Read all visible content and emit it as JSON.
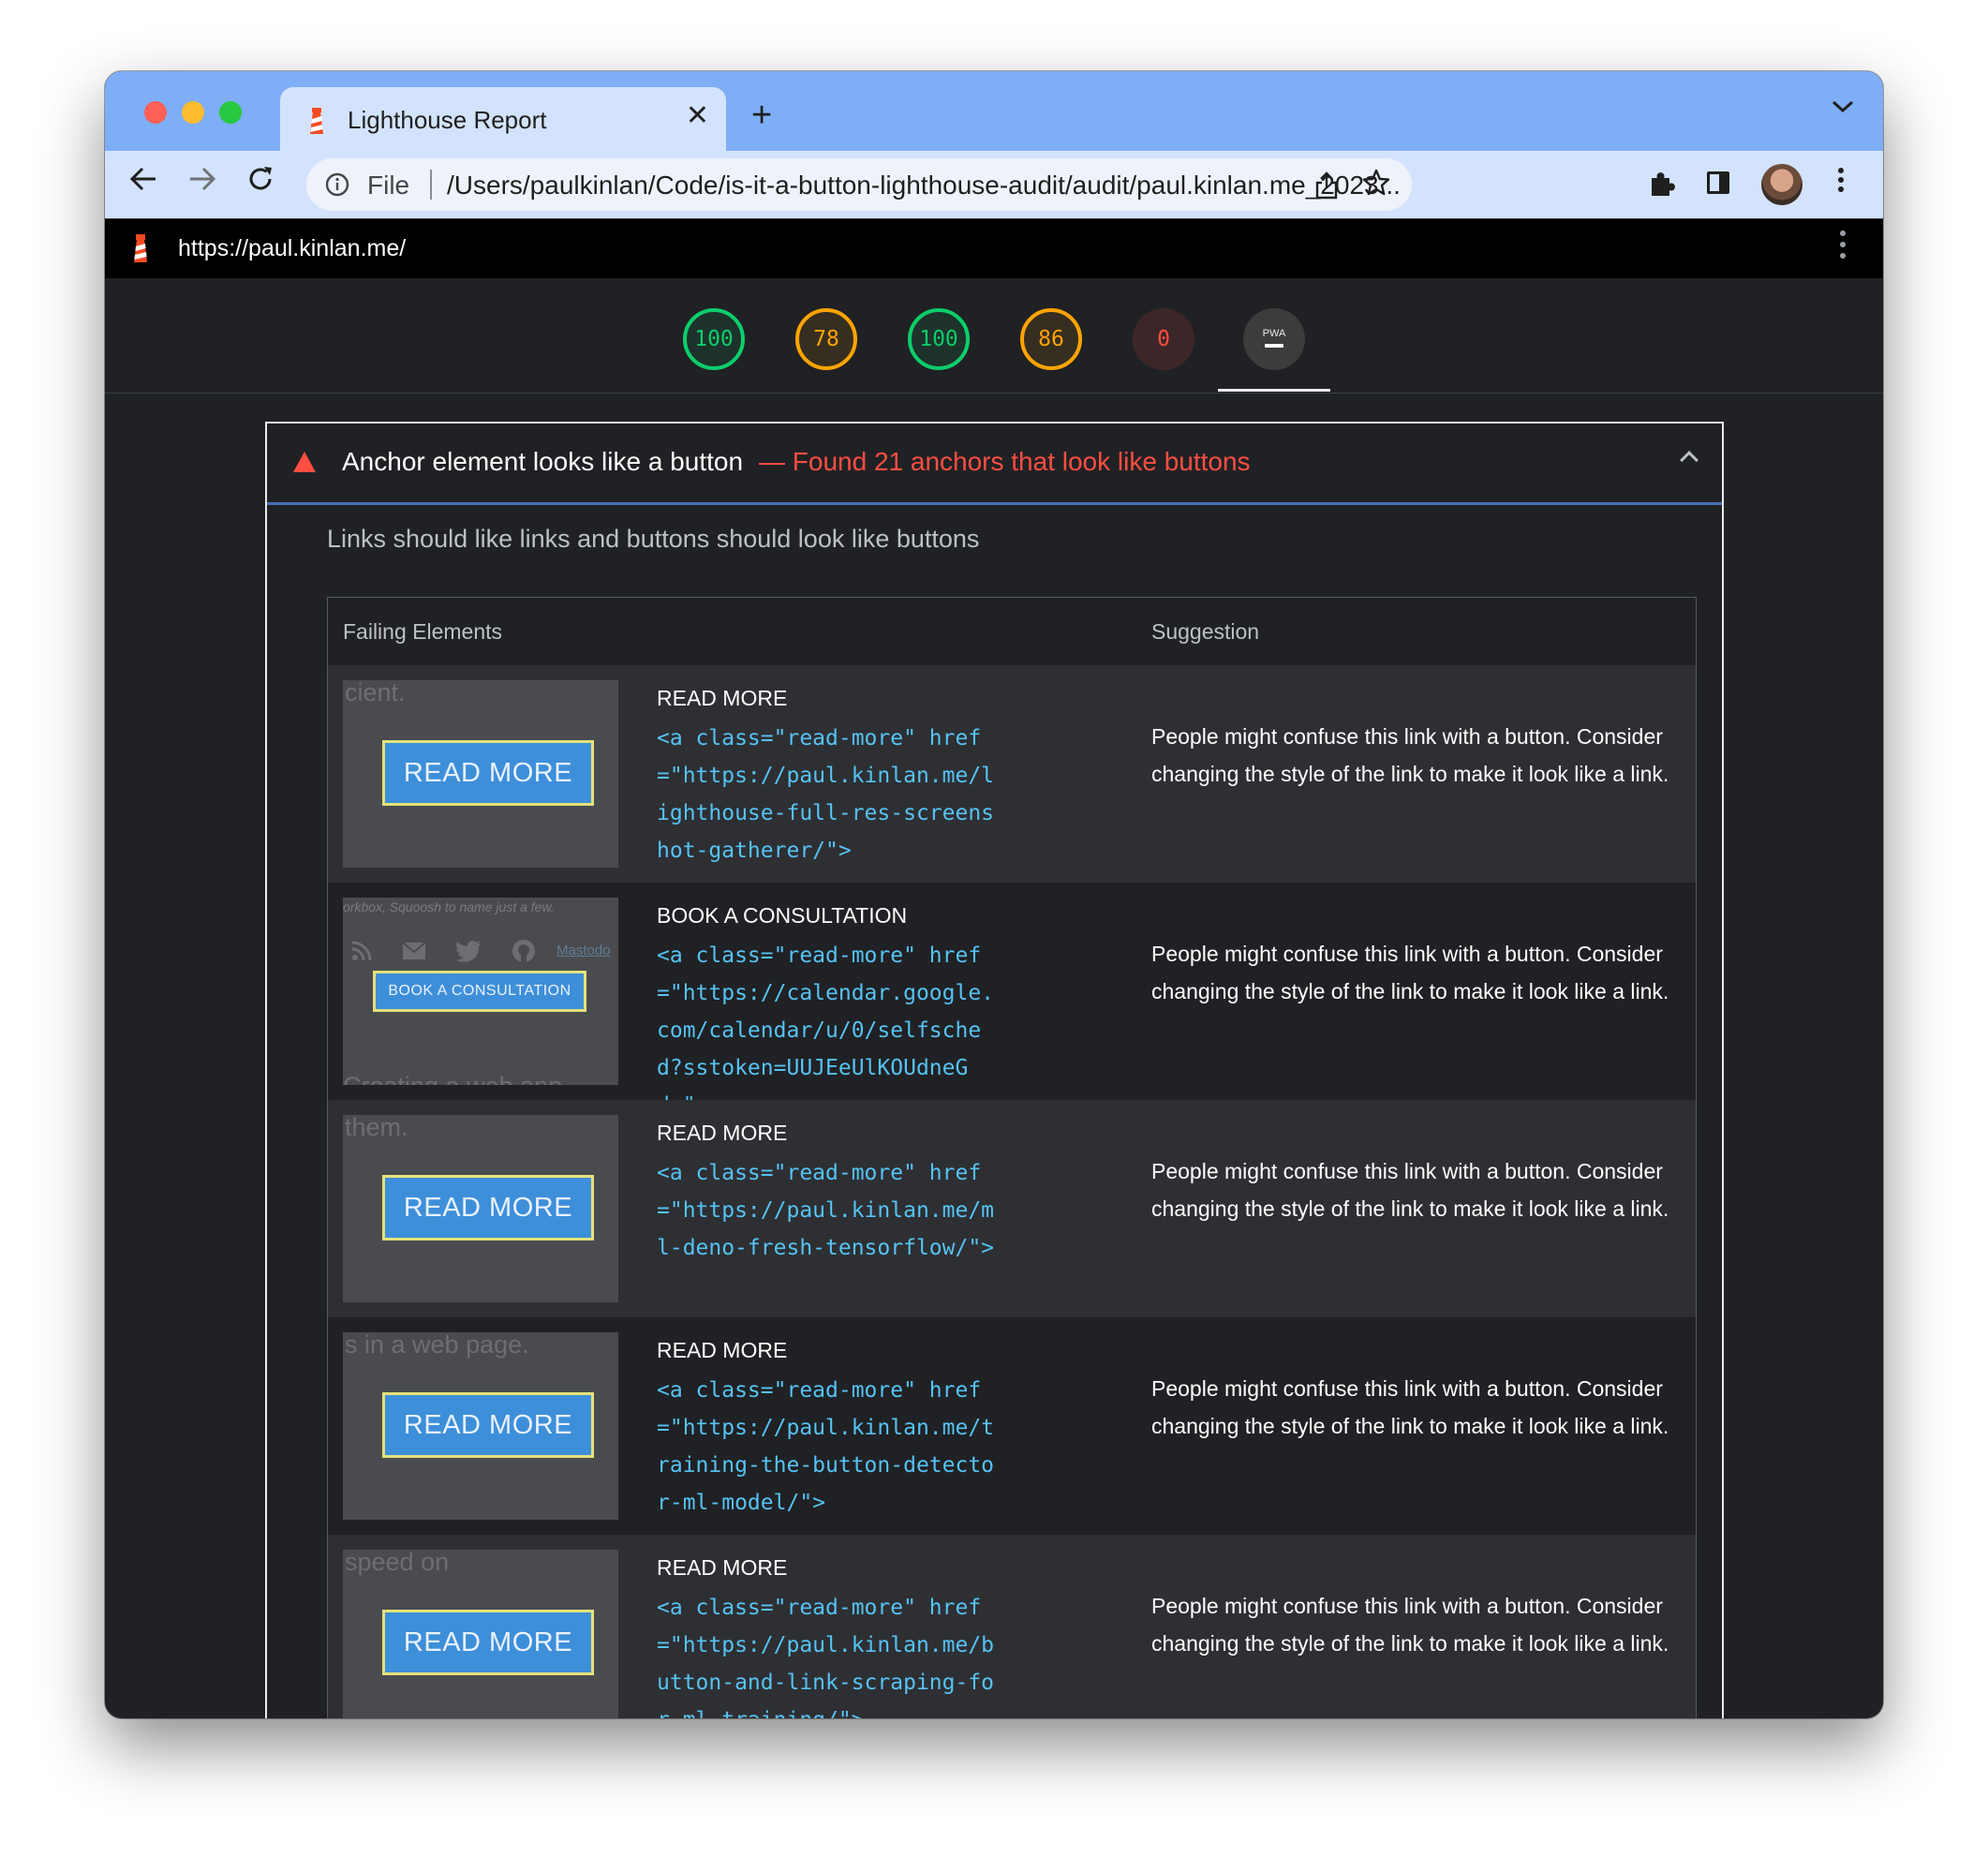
{
  "browser": {
    "tab_title": "Lighthouse Report",
    "tab_close": "✕",
    "new_tab": "+",
    "omnibox_scheme": "File",
    "omnibox_url": "/Users/paulkinlan/Code/is-it-a-button-lighthouse-audit/audit/paul.kinlan.me_2023..."
  },
  "report": {
    "url": "https://paul.kinlan.me/"
  },
  "scores": [
    {
      "value": "100",
      "status": "pass"
    },
    {
      "value": "78",
      "status": "average"
    },
    {
      "value": "100",
      "status": "pass"
    },
    {
      "value": "86",
      "status": "average"
    },
    {
      "value": "0",
      "status": "fail"
    }
  ],
  "pwa": {
    "label": "PWA",
    "active": true
  },
  "audit": {
    "title": "Anchor element looks like a button",
    "found": "— Found 21 anchors that look like buttons",
    "description": "Links should like links and buttons should look like buttons",
    "col_failing": "Failing Elements",
    "col_suggestion": "Suggestion",
    "rows": [
      {
        "thumb_context": "cient.",
        "thumb_button": "READ MORE",
        "label": "READ MORE",
        "code": "<a class=\"read-more\" href=\"https://paul.kinlan.me/lighthouse-full-res-screenshot-gatherer/\">",
        "suggestion": "People might confuse this link with a button. Consider changing the style of the link to make it look like a link."
      },
      {
        "thumb_context": "orkbox, Squoosh to name just a few.",
        "thumb_link": "Mastodo",
        "thumb_bottom": "Creating a web app",
        "thumb_button": "BOOK A CONSULTATION",
        "label": "BOOK A CONSULTATION",
        "code": "<a class=\"read-more\" href=\"https://calendar.google.com/calendar/u/0/selfsched?sstoken=UUJEeUlKOUdneGd…\">",
        "suggestion": "People might confuse this link with a button. Consider changing the style of the link to make it look like a link."
      },
      {
        "thumb_context": "them.",
        "thumb_button": "READ MORE",
        "label": "READ MORE",
        "code": "<a class=\"read-more\" href=\"https://paul.kinlan.me/ml-deno-fresh-tensorflow/\">",
        "suggestion": "People might confuse this link with a button. Consider changing the style of the link to make it look like a link."
      },
      {
        "thumb_context": "s in a web page.",
        "thumb_button": "READ MORE",
        "label": "READ MORE",
        "code": "<a class=\"read-more\" href=\"https://paul.kinlan.me/training-the-button-detector-ml-model/\">",
        "suggestion": "People might confuse this link with a button. Consider changing the style of the link to make it look like a link."
      },
      {
        "thumb_context": "speed on",
        "thumb_button": "READ MORE",
        "label": "READ MORE",
        "code": "<a class=\"read-more\" href=\"https://paul.kinlan.me/button-and-link-scraping-for-ml-training/\">",
        "suggestion": "People might confuse this link with a button. Consider changing the style of the link to make it look like a link."
      }
    ]
  },
  "colors": {
    "pass": "#0cce6b",
    "average": "#ffa400",
    "fail": "#ff4e42",
    "code": "#55c3f4"
  }
}
